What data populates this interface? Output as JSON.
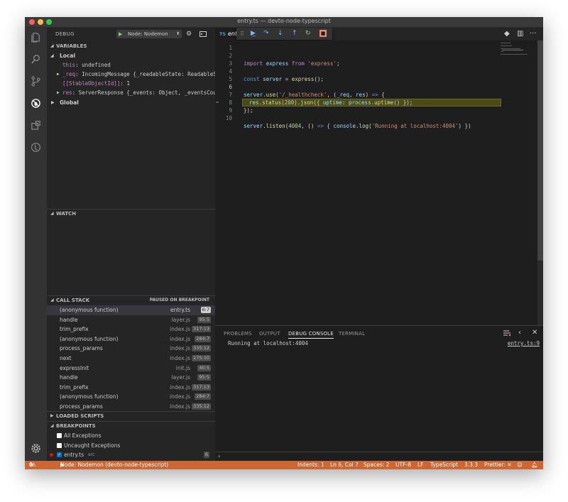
{
  "window": {
    "title": "entry.ts — devto-node-typescript"
  },
  "activity_bar": {
    "items": [
      "files-icon",
      "search-icon",
      "source-control-icon",
      "debug-icon",
      "extensions-icon",
      "remote-icon"
    ],
    "bottom": "gear-icon"
  },
  "debug_header": {
    "label": "DEBUG",
    "config": "Node: Nodemon"
  },
  "variables": {
    "header": "VARIABLES",
    "scope_local": "Local",
    "items": [
      {
        "key": "this",
        "value": "undefined"
      },
      {
        "key": "_req",
        "value": "IncomingMessage {_readableState: ReadableStat…"
      },
      {
        "key": "[[StableObjectId]]",
        "value": "1"
      },
      {
        "key": "res",
        "value": "ServerResponse {_events: Object, _eventsCount:…"
      }
    ],
    "scope_global": "Global"
  },
  "watch": {
    "header": "WATCH"
  },
  "call_stack": {
    "header": "CALL STACK",
    "status": "PAUSED ON BREAKPOINT",
    "frames": [
      {
        "fn": "(anonymous function)",
        "file": "entry.ts",
        "pos": "6:7"
      },
      {
        "fn": "handle",
        "file": "layer.js",
        "pos": "95:5"
      },
      {
        "fn": "trim_prefix",
        "file": "index.js",
        "pos": "317:13"
      },
      {
        "fn": "(anonymous function)",
        "file": "index.js",
        "pos": "284:7"
      },
      {
        "fn": "process_params",
        "file": "index.js",
        "pos": "335:12"
      },
      {
        "fn": "next",
        "file": "index.js",
        "pos": "275:10"
      },
      {
        "fn": "expressInit",
        "file": "init.js",
        "pos": "40:5"
      },
      {
        "fn": "handle",
        "file": "layer.js",
        "pos": "95:5"
      },
      {
        "fn": "trim_prefix",
        "file": "index.js",
        "pos": "317:13"
      },
      {
        "fn": "(anonymous function)",
        "file": "index.js",
        "pos": "284:7"
      },
      {
        "fn": "process_params",
        "file": "index.js",
        "pos": "335:12"
      }
    ]
  },
  "loaded_scripts": {
    "header": "LOADED SCRIPTS"
  },
  "breakpoints": {
    "header": "BREAKPOINTS",
    "all_exceptions": "All Exceptions",
    "uncaught_exceptions": "Uncaught Exceptions",
    "file": "entry.ts",
    "file_dir": "src",
    "file_line": "6"
  },
  "editor": {
    "tab": {
      "lang": "TS",
      "name": "entry.ts"
    },
    "line_numbers": [
      "1",
      "2",
      "3",
      "4",
      "5",
      "6",
      "7",
      "8",
      "9",
      "10"
    ],
    "current_line": "6",
    "code": {
      "l1": {
        "a": "import",
        "b": " express ",
        "c": "from",
        "d": " ",
        "e": "'express'",
        "f": ";"
      },
      "l3": {
        "a": "const",
        "b": " server ",
        "c": "= ",
        "d": "express",
        "e": "();"
      },
      "l5": {
        "a": "server",
        "b": ".",
        "c": "use",
        "d": "(",
        "e": "'/_healthcheck'",
        "f": ", (",
        "g": "_req",
        "h": ", ",
        "i": "res",
        "j": ") ",
        "k": "=>",
        "l": " {"
      },
      "l6": {
        "a": "res",
        "b": ".",
        "c": "status",
        "d": "(",
        "e": "200",
        "f": ").",
        "g": "json",
        "h": "({ ",
        "i": "uptime",
        "j": ": ",
        "k": "process",
        "l": ".",
        "m": "uptime",
        "n": "() });"
      },
      "l7": "});",
      "l9": {
        "a": "server",
        "b": ".",
        "c": "listen",
        "d": "(",
        "e": "4004",
        "f": ", () ",
        "g": "=>",
        "h": " { ",
        "i": "console",
        "j": ".",
        "k": "log",
        "l": "(",
        "m": "'Running at localhost:4004'",
        "n": ") })"
      }
    }
  },
  "panel": {
    "tabs": [
      "PROBLEMS",
      "OUTPUT",
      "DEBUG CONSOLE",
      "TERMINAL"
    ],
    "active_tab": "DEBUG CONSOLE",
    "console_output": "Running at localhost:4004",
    "console_source": "entry.ts:9",
    "repl_prompt": "›"
  },
  "status_bar": {
    "errors": "0",
    "warnings": "0",
    "debug_target": "Node: Nodemon (devto-node-typescript)",
    "indents": "Indents: 1",
    "cursor": "Ln 6, Col 7",
    "spaces": "Spaces: 2",
    "encoding": "UTF-8",
    "eol": "LF",
    "language": "TypeScript",
    "version": "3.3.3",
    "prettier": "Prettier: ✕"
  },
  "colors": {
    "status_bar_debug": "#cc6633",
    "line_highlight": "#4b4b18"
  }
}
